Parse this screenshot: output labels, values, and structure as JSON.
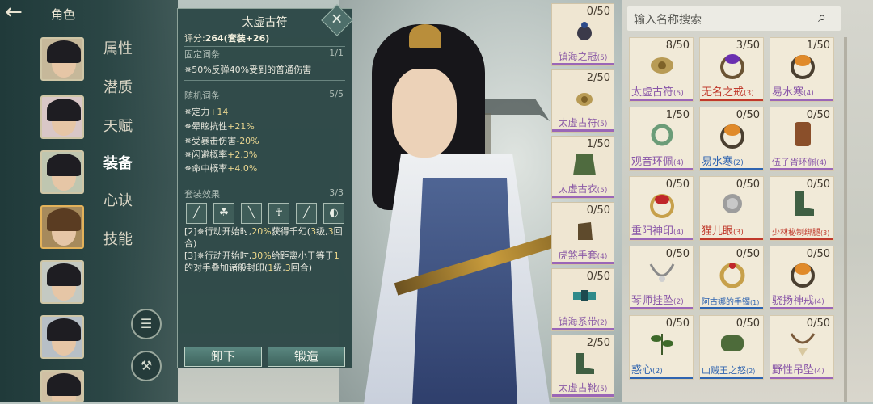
{
  "header": {
    "title": "角色"
  },
  "tabs": [
    {
      "label": "属性",
      "active": false
    },
    {
      "label": "潜质",
      "active": false
    },
    {
      "label": "天赋",
      "active": false
    },
    {
      "label": "装备",
      "active": true
    },
    {
      "label": "心诀",
      "active": false
    },
    {
      "label": "技能",
      "active": false
    }
  ],
  "detail": {
    "title": "太虚古符",
    "score_label": "评分:",
    "score_value": "264(套装+26)",
    "fixed_label": "固定词条",
    "fixed_count": "1/1",
    "fixed_line": "50%反弹40%受到的普通伤害",
    "random_label": "随机词条",
    "random_count": "5/5",
    "random_lines": [
      {
        "label": "定力",
        "value": "+14"
      },
      {
        "label": "晕眩抗性",
        "value": "+21%"
      },
      {
        "label": "受暴击伤害",
        "value": "-20%"
      },
      {
        "label": "闪避概率",
        "value": "+2.3%"
      },
      {
        "label": "命中概率",
        "value": "+4.0%"
      }
    ],
    "set_label": "套装效果",
    "set_count": "3/3",
    "set_effect_1": {
      "prefix": "[2]",
      "a": "行动开始时,",
      "b": "20%",
      "c": "获得千幻(",
      "d": "3",
      "e": "级,",
      "f": "3",
      "g": "回合)"
    },
    "set_effect_2": {
      "prefix": "[3]",
      "a": "行动开始时,",
      "b": "30%",
      "c": "给距离小于等于",
      "d": "1",
      "e": "的对手叠加诸般封印(",
      "f": "1",
      "g": "级,",
      "h": "3",
      "i": "回合)"
    },
    "unequip_label": "卸下",
    "forge_label": "锻造"
  },
  "equipped": [
    {
      "name": "镇海之冠",
      "count": "0/50"
    },
    {
      "name": "太虚古符",
      "count": "2/50"
    },
    {
      "name": "太虚古衣",
      "count": "1/50"
    },
    {
      "name": "虎煞手套",
      "count": "0/50"
    },
    {
      "name": "镇海系带",
      "count": "0/50"
    },
    {
      "name": "太虚古靴",
      "count": "2/50"
    }
  ],
  "equipped_grades": [
    "(5)",
    "(5)",
    "(5)",
    "(4)",
    "(2)",
    "(5)"
  ],
  "search": {
    "placeholder": "输入名称搜索"
  },
  "inventory": [
    {
      "name": "太虚古符",
      "grade": "(5)",
      "count": "8/50"
    },
    {
      "name": "无名之戒",
      "grade": "(3)",
      "count": "3/50"
    },
    {
      "name": "易水寒",
      "grade": "(4)",
      "count": "1/50"
    },
    {
      "name": "观音环佩",
      "grade": "(4)",
      "count": "1/50"
    },
    {
      "name": "易水寒",
      "grade": "(2)",
      "count": "0/50"
    },
    {
      "name": "伍子胥环佩",
      "grade": "(4)",
      "count": "0/50"
    },
    {
      "name": "重阳神印",
      "grade": "(4)",
      "count": "0/50"
    },
    {
      "name": "猫儿眼",
      "grade": "(3)",
      "count": "0/50"
    },
    {
      "name": "少林秘制绑腿",
      "grade": "(3)",
      "count": "0/50"
    },
    {
      "name": "琴师挂坠",
      "grade": "(2)",
      "count": "0/50"
    },
    {
      "name": "阿古娜的手镯",
      "grade": "(1)",
      "count": "0/50"
    },
    {
      "name": "骁扬神戒",
      "grade": "(4)",
      "count": "0/50"
    },
    {
      "name": "惑心",
      "grade": "(2)",
      "count": "0/50"
    },
    {
      "name": "山贼王之怒",
      "grade": "(2)",
      "count": "0/50"
    },
    {
      "name": "野性吊坠",
      "grade": "(4)",
      "count": "0/50"
    }
  ],
  "colors": {
    "accent": "#e3b25a",
    "grade_purple": "#9a66b7",
    "grade_red": "#c0392b",
    "grade_blue": "#2f64b0",
    "stat_value": "#e6d48f"
  },
  "icons": {
    "back": "arrow-left",
    "close": "close",
    "search": "magnifier",
    "robe_btn": "robe",
    "sweep_btn": "broom"
  }
}
